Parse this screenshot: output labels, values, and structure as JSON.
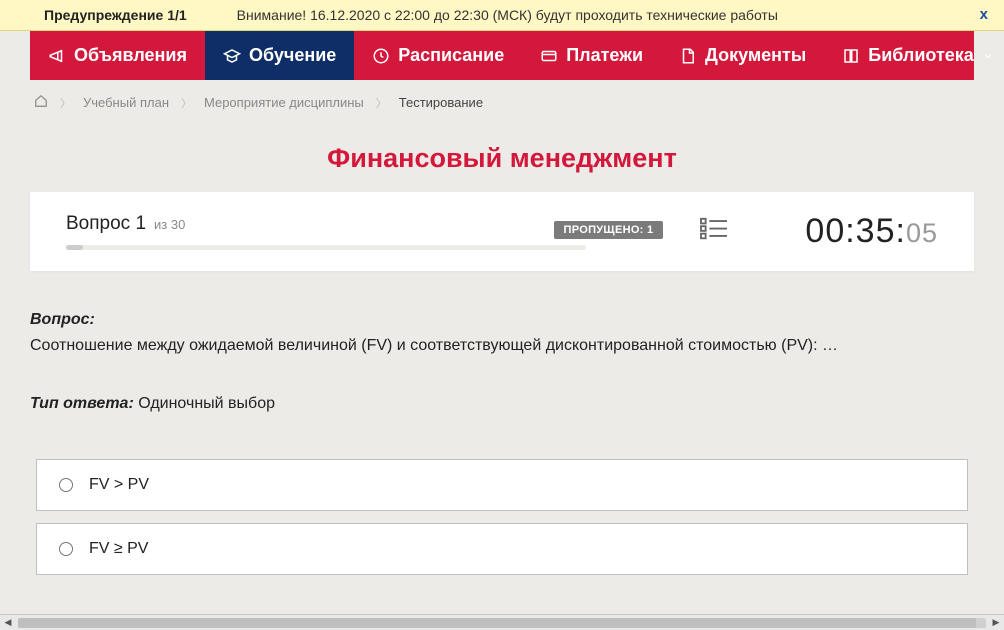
{
  "warning": {
    "label": "Предупреждение 1/1",
    "text": "Внимание! 16.12.2020 с 22:00 до 22:30 (МСК) будут проходить технические работы",
    "close": "x"
  },
  "nav": {
    "items": [
      {
        "label": "Объявления",
        "active": false
      },
      {
        "label": "Обучение",
        "active": true
      },
      {
        "label": "Расписание",
        "active": false
      },
      {
        "label": "Платежи",
        "active": false
      },
      {
        "label": "Документы",
        "active": false
      },
      {
        "label": "Библиотека",
        "active": false
      }
    ]
  },
  "breadcrumbs": {
    "items": [
      "Учебный план",
      "Мероприятие дисциплины",
      "Тестирование"
    ]
  },
  "pageTitle": "Финансовый менеджмент",
  "quiz": {
    "questionLabel": "Вопрос 1",
    "ofTotal": "из 30",
    "skipped": "ПРОПУЩЕНО: 1",
    "timerMain": "00:35:",
    "timerSecs": "05"
  },
  "content": {
    "questionLabel": "Вопрос:",
    "questionText": "Соотношение между ожидаемой величиной (FV) и соответствующей дисконтированной стоимостью (PV): …",
    "answerTypeLabel": "Тип ответа:",
    "answerTypeValue": " Одиночный выбор",
    "options": [
      "FV > PV",
      "FV ≥ PV"
    ]
  }
}
